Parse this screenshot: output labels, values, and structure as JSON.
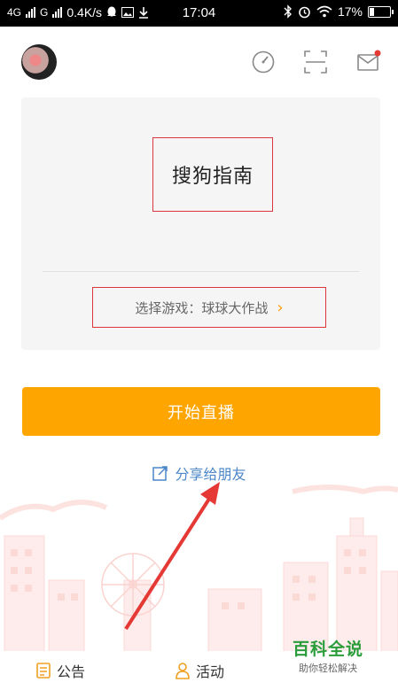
{
  "status_bar": {
    "network_1": "4G",
    "network_2": "G",
    "speed": "0.4K/s",
    "time": "17:04",
    "battery": "17%"
  },
  "top_bar": {
    "icons": [
      "speedometer-icon",
      "scan-icon",
      "mail-icon"
    ],
    "mail_has_badge": true
  },
  "card": {
    "title": "搜狗指南",
    "game_label": "选择游戏：球球大作战",
    "arrow": "›"
  },
  "start_button": {
    "label": "开始直播"
  },
  "share": {
    "label": "分享给朋友"
  },
  "bottom_nav": {
    "items": [
      {
        "label": "公告",
        "icon": "notice-icon"
      },
      {
        "label": "活动",
        "icon": "person-icon"
      }
    ]
  },
  "watermark": {
    "title": "百科全说",
    "subtitle": "助你轻松解决"
  },
  "colors": {
    "accent": "#ffa500",
    "share": "#4a86c8",
    "highlight_box": "#d9363e",
    "watermark": "#2a9d3a"
  }
}
